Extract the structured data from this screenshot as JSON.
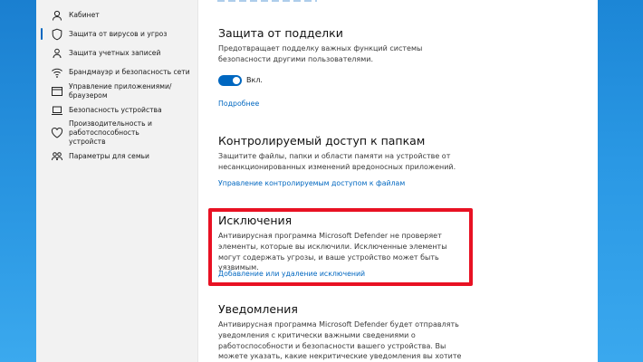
{
  "colors": {
    "accent": "#0067c0",
    "highlight_border": "#e81123",
    "desktop": "#2a98e4"
  },
  "sidebar": {
    "items": [
      {
        "label": "Кабинет",
        "icon": "person-icon"
      },
      {
        "label": "Защита от вирусов и угроз",
        "icon": "shield-icon",
        "active": true
      },
      {
        "label": "Защита учетных записей",
        "icon": "account-icon"
      },
      {
        "label": "Брандмауэр и безопасность сети",
        "icon": "wifi-icon"
      },
      {
        "label": "Управление приложениями/браузером",
        "icon": "app-browser-icon"
      },
      {
        "label": "Безопасность устройства",
        "icon": "laptop-icon"
      },
      {
        "label": "Производительность и работоспособность устройств",
        "icon": "heart-icon"
      },
      {
        "label": "Параметры для семьи",
        "icon": "family-icon"
      }
    ]
  },
  "tamper": {
    "title": "Защита от подделки",
    "description": "Предотвращает подделку важных функций системы безопасности другими пользователями.",
    "toggle_state": "Вкл.",
    "toggle_on": true,
    "link": "Подробнее"
  },
  "folder_access": {
    "title": "Контролируемый доступ к папкам",
    "description": "Защитите файлы, папки и области памяти на устройстве от несанкционированных изменений вредоносных приложений.",
    "link": "Управление контролируемым доступом к файлам"
  },
  "exclusions": {
    "title": "Исключения",
    "description": "Антивирусная программа Microsoft Defender не проверяет элементы, которые вы исключили. Исключенные элементы могут содержать угрозы, и ваше устройство может быть уязвимым.",
    "link": "Добавление или удаление исключений"
  },
  "notifications": {
    "title": "Уведомления",
    "description": "Антивирусная программа Microsoft Defender будет отправлять уведомления с критически важными сведениями о работоспособности и безопасности вашего устройства. Вы можете указать, какие некритические уведомления вы хотите получать."
  }
}
